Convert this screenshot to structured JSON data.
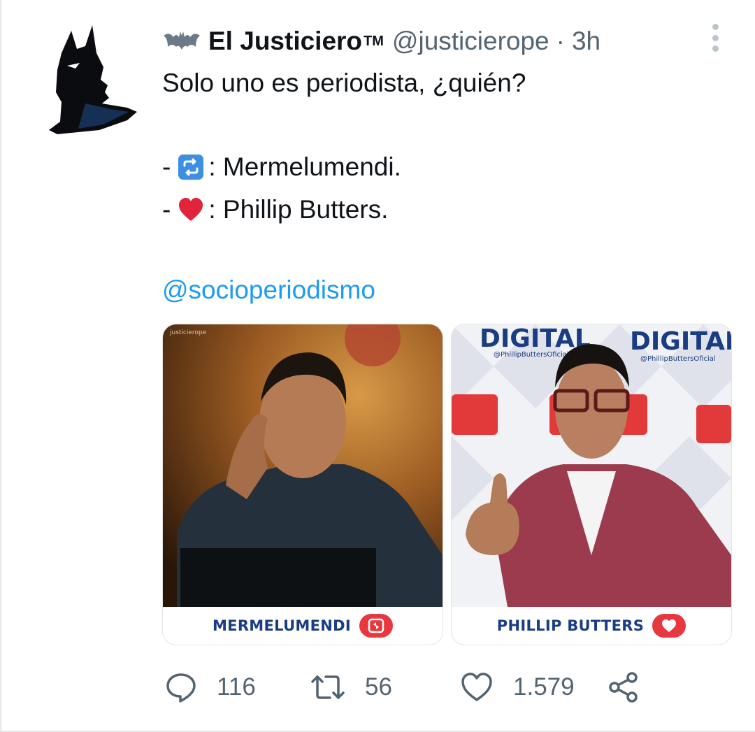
{
  "tweet": {
    "display_name": "El Justiciero",
    "trademark": "TM",
    "handle": "@justicierope",
    "separator": "·",
    "time": "3h",
    "lines": {
      "line1": "Solo uno es periodista, ¿quién?",
      "line2_prefix": "-",
      "line2_text": ": Mermelumendi.",
      "line3_prefix": "-",
      "line3_text": ": Phillip Butters."
    },
    "mention": "@socioperiodismo"
  },
  "media": {
    "left": {
      "caption": "MERMELUMENDI",
      "watermark": "justicierope"
    },
    "right": {
      "caption": "PHILLIP BUTTERS",
      "banner_word": "DIGITAL",
      "banner_handle": "@PhillipButtersOficial"
    }
  },
  "actions": {
    "replies": "116",
    "retweets": "56",
    "likes": "1.579"
  },
  "icons": {
    "reply": "speech-bubble-icon",
    "retweet": "retweet-icon",
    "like": "heart-icon",
    "share": "share-icon",
    "more": "vertical-ellipsis-icon",
    "bat": "bat-emoji-icon"
  },
  "colors": {
    "link": "#1d9bf0",
    "muted": "#536471",
    "caption": "#1a3c83",
    "badge": "#e8383f"
  }
}
